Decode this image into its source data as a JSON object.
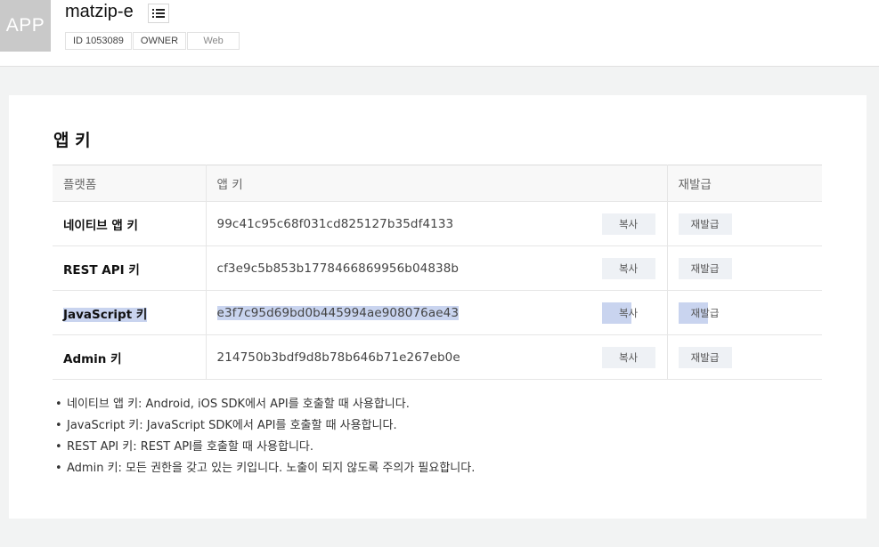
{
  "header": {
    "app_thumb": "APP",
    "app_name": "matzip-e",
    "tags": {
      "id": "ID 1053089",
      "role": "OWNER",
      "platform": "Web"
    }
  },
  "section": {
    "title": "앱 키",
    "columns": {
      "platform": "플랫폼",
      "app_key": "앱 키",
      "reissue": "재발급"
    },
    "rows": [
      {
        "platform": "네이티브 앱 키",
        "key": "99c41c95c68f031cd825127b35df4133",
        "copy": "복사",
        "reissue": "재발급"
      },
      {
        "platform": "REST API 키",
        "key": "cf3e9c5b853b1778466869956b04838b",
        "copy": "복사",
        "reissue": "재발급"
      },
      {
        "platform": "JavaScript 키",
        "key": "e3f7c95d69bd0b445994ae908076ae43",
        "copy": "복사",
        "reissue": "재발급",
        "selected": true
      },
      {
        "platform": "Admin 키",
        "key": "214750b3bdf9d8b78b646b71e267eb0e",
        "copy": "복사",
        "reissue": "재발급"
      }
    ],
    "notes": [
      "네이티브 앱 키: Android, iOS SDK에서 API를 호출할 때 사용합니다.",
      "JavaScript 키: JavaScript SDK에서 API를 호출할 때 사용합니다.",
      "REST API 키: REST API를 호출할 때 사용합니다.",
      "Admin 키: 모든 권한을 갖고 있는 키입니다. 노출이 되지 않도록 주의가 필요합니다."
    ]
  },
  "colors": {
    "selection": "#c9d4ef",
    "button_bg": "#eef1f5",
    "panel_bg": "#ffffff",
    "page_bg": "#f2f3f3"
  },
  "icons": {
    "menu": "list-icon"
  }
}
